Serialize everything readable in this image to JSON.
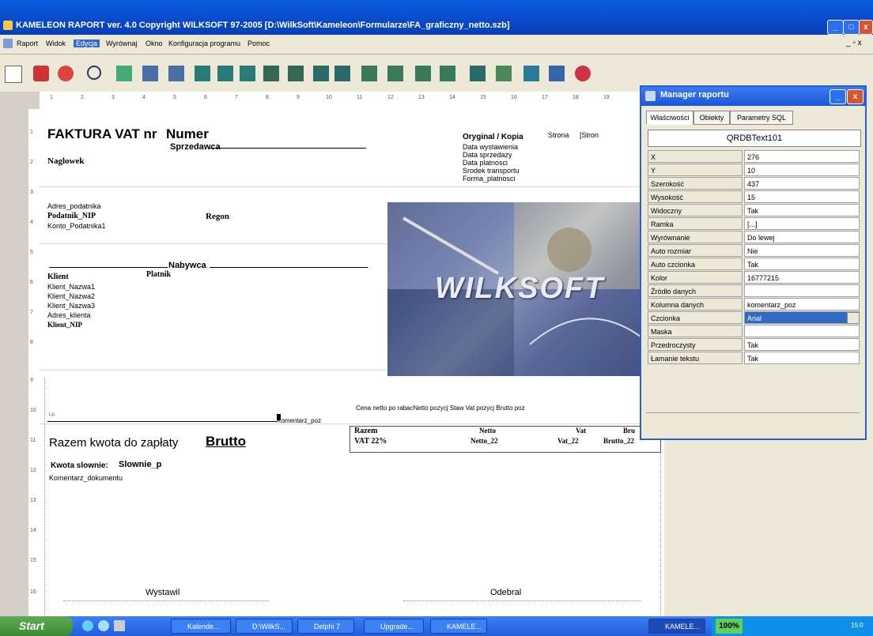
{
  "window": {
    "title": "KAMELEON RAPORT ver. 4.0 Copyright  WILKSOFT 97-2005   [D:\\WilkSoft\\Kameleon\\Formularze\\FA_graficzny_netto.szb]"
  },
  "menu": [
    "Raport",
    "Widok",
    "Edycja",
    "Wyrównaj",
    "Okno",
    "Konfiguracja programu",
    "Pomoc"
  ],
  "menu_active": "Edycja",
  "ruler": [
    "1",
    "2",
    "3",
    "4",
    "5",
    "6",
    "7",
    "8",
    "9",
    "10",
    "11",
    "12",
    "13",
    "14",
    "15",
    "16",
    "17",
    "18",
    "19"
  ],
  "vruler": [
    "1",
    "2",
    "3",
    "4",
    "5",
    "6",
    "7",
    "8",
    "9",
    "10",
    "11",
    "12",
    "13",
    "14",
    "15",
    "16"
  ],
  "report": {
    "header_title": "FAKTURA VAT nr",
    "numer": "Numer",
    "sprzedawca": "Sprzedawca",
    "naglowek": "Naglowek",
    "oryginal": "Oryginal / Kopia",
    "strona": "Strona",
    "strona2": "[Stron",
    "date_fields": [
      "Data  wystawienia",
      "Data  sprzedazy",
      "Data  platnosci",
      "Srodek  transportu",
      "Forma_platnosci"
    ],
    "adres_podatnika": "Adres_podatnika",
    "podatnik_nip": "Podatnik_NIP",
    "regon": "Regon",
    "konto": "Konto_Podatnika1",
    "nabywca": "Nabywca",
    "klient": "Klient",
    "platnik": "Platnik",
    "klient_fields": [
      "Klient_Nazwa1",
      "Klient_Nazwa2",
      "Klient_Nazwa3",
      "Adres_klienta",
      "Klient_NIP"
    ],
    "picture_text": "WILKSOFT",
    "lp": "Lp.",
    "col_headers": "Cena  netto  po  rabacNetto  pozycj   Staw Vat  pozycj   Brutto  poz",
    "komentarz_poz": "Komentarz_poz",
    "razem_label": "Razem kwota do zapłaty",
    "brutto": "Brutto",
    "razem": "Razem",
    "vat22": "VAT 22%",
    "netto": "Netto",
    "netto22": "Netto_22",
    "vat": "Vat",
    "vat_22": "Vat_22",
    "bru": "Bru",
    "brutto22": "Brutto_22",
    "kwota_slownie": "Kwota slownie:",
    "slownie": "Slownie_p",
    "komentarz_dok": "Komentarz_dokumentu",
    "wystawil": "Wystawil",
    "odebral": "Odebral"
  },
  "manager": {
    "title": "Manager raportu",
    "tabs": [
      "Właściwości",
      "Obiekty",
      "Parametry SQL"
    ],
    "object": "QRDBText101",
    "props": [
      {
        "name": "X",
        "value": "276"
      },
      {
        "name": "Y",
        "value": "10"
      },
      {
        "name": "Szerokość",
        "value": "437"
      },
      {
        "name": "Wysokość",
        "value": "15"
      },
      {
        "name": "Widoczny",
        "value": "Tak"
      },
      {
        "name": "Ramka",
        "value": "[...]"
      },
      {
        "name": "Wyrównanie",
        "value": "Do lewej"
      },
      {
        "name": "Auto rozmiar",
        "value": "Nie"
      },
      {
        "name": "Auto czcionka",
        "value": "Tak"
      },
      {
        "name": "Kolor",
        "value": "16777215"
      },
      {
        "name": "Źródło danych",
        "value": ""
      },
      {
        "name": "Kolumna danych",
        "value": "komentarz_poz"
      },
      {
        "name": "Czcionka",
        "value": "Arial"
      },
      {
        "name": "Maska",
        "value": ""
      },
      {
        "name": "Przedroczysty",
        "value": "Tak"
      },
      {
        "name": "Łamanie tekstu",
        "value": "Tak"
      }
    ]
  },
  "taskbar": {
    "start": "Start",
    "tasks": [
      "Kalende...",
      "D:\\WilkS...",
      "Delphi 7",
      "Upgrade...",
      "KAMELE...",
      "KAMELE..."
    ],
    "percent": "100%",
    "clock": "15:0"
  }
}
